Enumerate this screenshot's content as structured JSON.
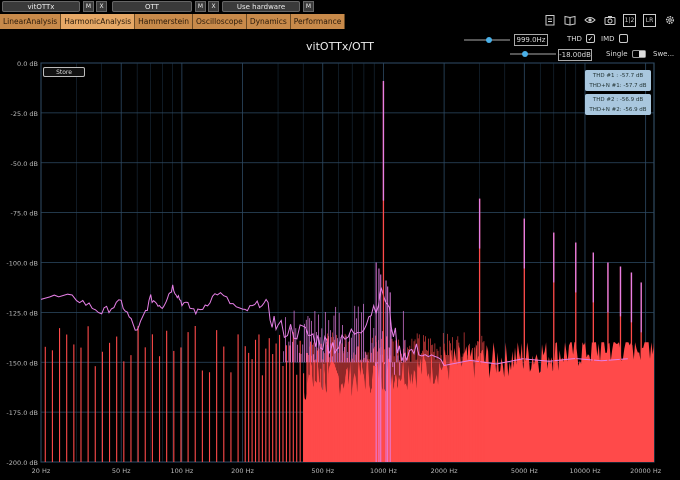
{
  "top": {
    "slot1": "vitOTTx",
    "slot2": "OTT",
    "slot3": "Use hardware",
    "m_label": "M",
    "x_label": "X"
  },
  "tabs": [
    "LinearAnalysis",
    "HarmonicAnalysis",
    "Hammerstein",
    "Oscilloscope",
    "Dynamics",
    "Performance"
  ],
  "active_tab": "HarmonicAnalysis",
  "toolbar_icons": [
    "clipboard-icon",
    "book-icon",
    "eye-icon",
    "camera-icon",
    "one-two-icon",
    "lr-icon",
    "gear-icon"
  ],
  "toolbar_text": {
    "one_two": "1|2",
    "lr": "LR"
  },
  "title": "vitOTTx/OTT",
  "controls": {
    "frequency": "999.0Hz",
    "level": "-18.00dB",
    "thd": "THD",
    "thd_checked": "✓",
    "imd": "IMD",
    "single": "Single",
    "sweep": "Swe..."
  },
  "store_label": "Store",
  "readouts": [
    {
      "line1": "THD #1 : -57.7 dB",
      "line2": "THD+N #1: -57.7 dB"
    },
    {
      "line1": "THD #2 : -56.9 dB",
      "line2": "THD+N #2: -56.9 dB"
    }
  ],
  "colors": {
    "accent": "#4ab0e8",
    "tab": "#c88a4a",
    "series1": "#ff4a4a",
    "series2": "#e67fe6",
    "grid": "#2d4a63"
  },
  "chart_data": {
    "type": "line",
    "xscale": "log",
    "xlim": [
      20,
      22000
    ],
    "ylim": [
      -200,
      0
    ],
    "grid": true,
    "x_ticks": [
      20,
      50,
      100,
      200,
      500,
      1000,
      2000,
      5000,
      10000,
      20000
    ],
    "x_tick_labels": [
      "20 Hz",
      "50 Hz",
      "100 Hz",
      "200 Hz",
      "500 Hz",
      "1000 Hz",
      "2000 Hz",
      "5000 Hz",
      "10000 Hz",
      "20000 Hz"
    ],
    "y_ticks": [
      0,
      -25,
      -50,
      -75,
      -100,
      -125,
      -150,
      -175,
      -200
    ],
    "y_tick_labels": [
      "0.0 dB",
      "-25.0 dB",
      "-50.0 dB",
      "-75.0 dB",
      "-100.0 dB",
      "-125.0 dB",
      "-150.0 dB",
      "-175.0 dB",
      "-200.0 dB"
    ],
    "series": [
      {
        "color": "#ff4a4a",
        "points": [
          [
            20,
            -130
          ],
          [
            22,
            -200
          ],
          [
            30,
            -140
          ],
          [
            40,
            -200
          ],
          [
            50,
            -140
          ],
          [
            70,
            -200
          ],
          [
            100,
            -150
          ],
          [
            200,
            -145
          ],
          [
            300,
            -160
          ],
          [
            500,
            -150
          ],
          [
            800,
            -145
          ],
          [
            1000,
            -9
          ],
          [
            1200,
            -150
          ],
          [
            2000,
            -145
          ],
          [
            3000,
            -70
          ],
          [
            4000,
            -135
          ],
          [
            5000,
            -80
          ],
          [
            6000,
            -140
          ],
          [
            7000,
            -85
          ],
          [
            9000,
            -140
          ],
          [
            10000,
            -90
          ],
          [
            15000,
            -100
          ],
          [
            20000,
            -110
          ],
          [
            22000,
            -145
          ]
        ]
      },
      {
        "color": "#e67fe6",
        "points": [
          [
            20,
            -117
          ],
          [
            30,
            -118
          ],
          [
            40,
            -125
          ],
          [
            50,
            -120
          ],
          [
            60,
            -135
          ],
          [
            70,
            -118
          ],
          [
            80,
            -122
          ],
          [
            90,
            -112
          ],
          [
            100,
            -120
          ],
          [
            120,
            -125
          ],
          [
            150,
            -115
          ],
          [
            200,
            -125
          ],
          [
            250,
            -120
          ],
          [
            300,
            -133
          ],
          [
            400,
            -135
          ],
          [
            500,
            -140
          ],
          [
            600,
            -142
          ],
          [
            800,
            -130
          ],
          [
            1000,
            -115
          ],
          [
            1200,
            -145
          ],
          [
            1500,
            -145
          ],
          [
            2000,
            -150
          ],
          [
            22000,
            -150
          ]
        ]
      }
    ],
    "harmonic_peaks": [
      {
        "freq": 1000,
        "db": -9
      },
      {
        "freq": 3000,
        "db": -68
      },
      {
        "freq": 5000,
        "db": -78
      },
      {
        "freq": 7000,
        "db": -85
      },
      {
        "freq": 9000,
        "db": -90
      },
      {
        "freq": 11000,
        "db": -95
      },
      {
        "freq": 13000,
        "db": -100
      },
      {
        "freq": 15000,
        "db": -102
      },
      {
        "freq": 17000,
        "db": -105
      },
      {
        "freq": 19000,
        "db": -110
      }
    ]
  }
}
